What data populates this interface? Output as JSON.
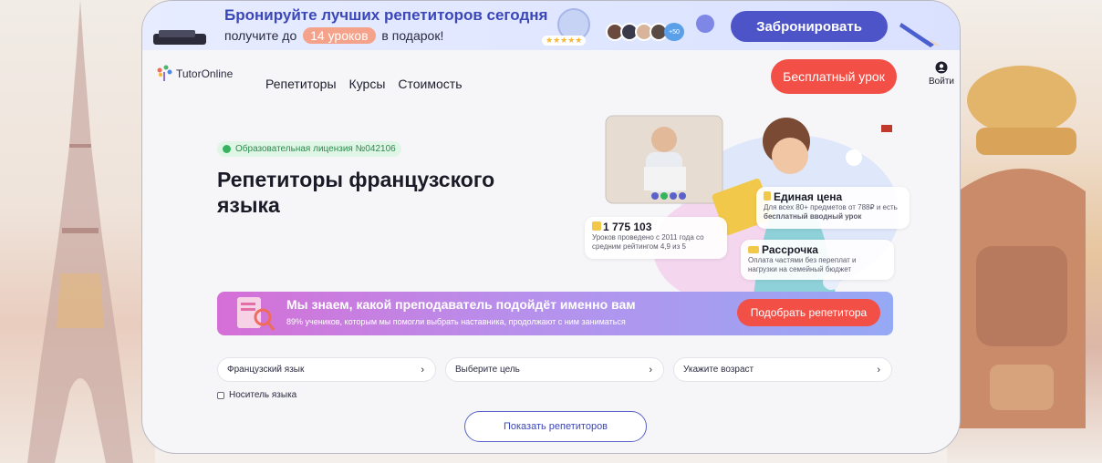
{
  "promo": {
    "title": "Бронируйте лучших репетиторов сегодня",
    "sub_before": "получите до",
    "badge": "14 уроков",
    "sub_after": "в подарок!",
    "stars": "★★★★★",
    "avatars_count": "+50",
    "button": "Забронировать"
  },
  "header": {
    "logo": "TutorOnline",
    "nav": [
      "Репетиторы",
      "Курсы",
      "Стоимость"
    ],
    "cta": "Бесплатный урок",
    "login": "Войти"
  },
  "hero": {
    "license": "Образовательная лицензия №042106",
    "title": "Репетиторы французского языка",
    "stats": {
      "lessons_value": "1 775 103",
      "lessons_text": "Уроков проведено с 2011 года со средним рейтингом 4,9 из 5",
      "price_title": "Единая цена",
      "price_text_1": "Для всех 80+ предметов от 788₽ и есть ",
      "price_text_bold": "бесплатный вводный урок",
      "installment_title": "Рассрочка",
      "installment_text": "Оплата частями без переплат и нагрузки на семейный бюджет"
    }
  },
  "match": {
    "title": "Мы знаем, какой преподаватель подойдёт именно вам",
    "sub": "89% учеников, которым мы помогли выбрать наставника, продолжают с ним заниматься",
    "button": "Подобрать репетитора"
  },
  "filters": {
    "subject": "Французский язык",
    "goal": "Выберите цель",
    "age": "Укажите возраст",
    "native": "Носитель языка",
    "show": "Показать репетиторов"
  },
  "colors": {
    "brand": "#4c54c8",
    "accent": "#f24f46",
    "license": "#35b35f"
  }
}
